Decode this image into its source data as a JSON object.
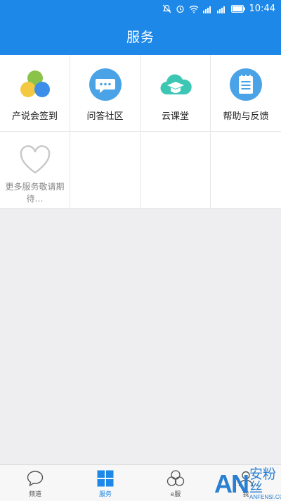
{
  "status_bar": {
    "time": "10:44"
  },
  "header": {
    "title": "服务"
  },
  "services": [
    {
      "label": "产说会签到",
      "icon": "triple-circle-icon"
    },
    {
      "label": "问答社区",
      "icon": "chat-bubble-icon"
    },
    {
      "label": "云课堂",
      "icon": "cloud-graduation-icon"
    },
    {
      "label": "帮助与反馈",
      "icon": "notepad-icon"
    }
  ],
  "more": {
    "label": "更多服务敬请期待…",
    "icon": "heart-outline-icon"
  },
  "tabs": [
    {
      "label": "频道",
      "icon": "chat-bubble-outline-icon",
      "active": false
    },
    {
      "label": "服务",
      "icon": "grid-icon",
      "active": true
    },
    {
      "label": "e服",
      "icon": "triple-circle-outline-icon",
      "active": false
    },
    {
      "label": "我",
      "icon": "person-icon",
      "active": false
    }
  ],
  "watermark": {
    "mark": "AN",
    "cn": "安粉丝",
    "en": "ANFENSI.COM"
  },
  "colors": {
    "primary": "#1e88e8",
    "background": "#eeeef0"
  }
}
